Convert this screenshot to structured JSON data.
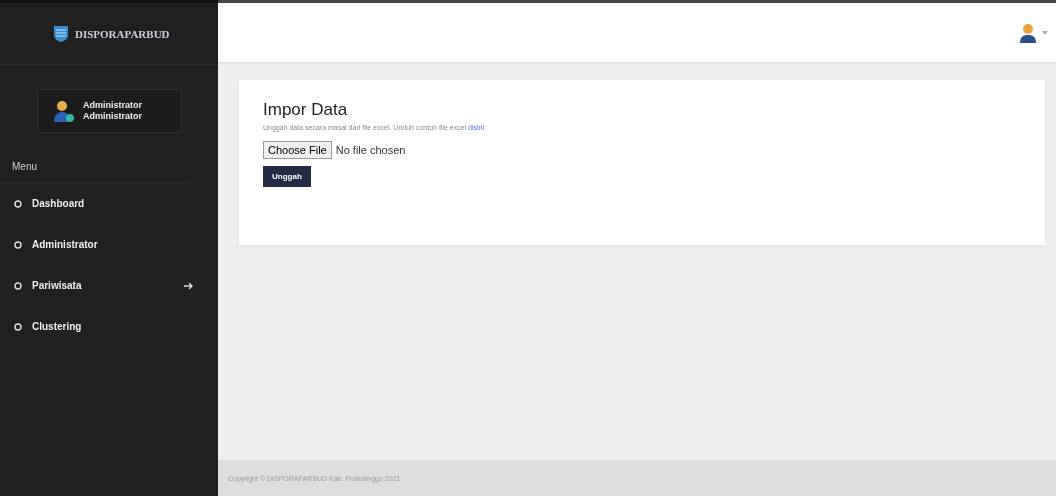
{
  "sidebar": {
    "brand": "DISPORAPARBUD",
    "user": {
      "name": "Administrator",
      "role": "Administrator"
    },
    "menu_heading": "Menu",
    "items": [
      {
        "label": "Dashboard",
        "has_submenu": false
      },
      {
        "label": "Administrator",
        "has_submenu": false
      },
      {
        "label": "Pariwisata",
        "has_submenu": true
      },
      {
        "label": "Clustering",
        "has_submenu": false
      }
    ]
  },
  "card": {
    "title": "Impor Data",
    "description": "Unggah data secara masal dari file excel. Unduh contoh file excel ",
    "link": "disini",
    "file_button": "Choose File",
    "file_status": "No file chosen",
    "submit": "Unggah"
  },
  "footer": "Copyright © DISPORAPARBUD Kab. Probolinggo 2021"
}
